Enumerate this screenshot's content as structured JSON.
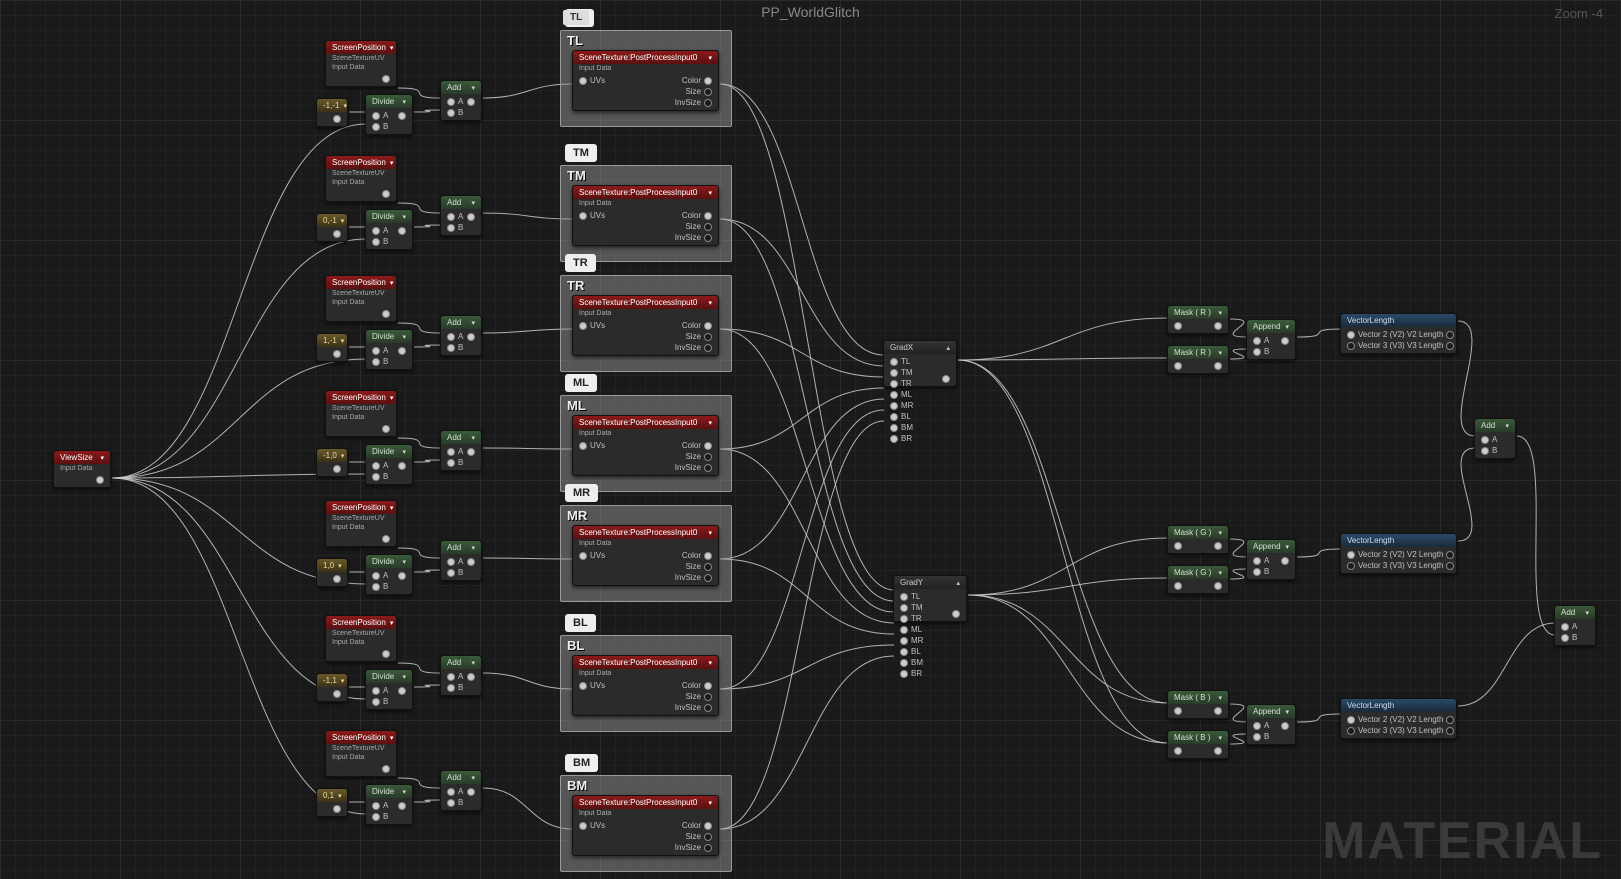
{
  "title": "PP_WorldGlitch",
  "zoom": "Zoom -4",
  "watermark": "MATERIAL",
  "labels": {
    "screenPosition": "ScreenPosition",
    "sceneTextureUV": "SceneTextureUV",
    "inputData": "Input Data",
    "viewSize": "ViewSize",
    "divide": "Divide",
    "add": "Add",
    "sceneTexture": "SceneTexture:PostProcessInput0",
    "uvs": "UVs",
    "color": "Color",
    "size": "Size",
    "invSize": "InvSize",
    "gradX": "GradX",
    "gradY": "GradY",
    "a": "A",
    "b": "B",
    "maskR": "Mask ( R )",
    "maskG": "Mask ( G )",
    "maskB": "Mask ( B )",
    "append": "Append",
    "vectorLength": "VectorLength",
    "v2": "Vector 2 (V2)  V2 Length",
    "v3": "Vector 3 (V3)  V3 Length",
    "tl": "TL",
    "tm": "TM",
    "tr": "TR",
    "ml": "ML",
    "mr": "MR",
    "bl": "BL",
    "bm": "BM",
    "br": "BR"
  },
  "offsets": [
    "-1,-1",
    "0,-1",
    "1,-1",
    "-1,0",
    "1,0",
    "-1,1",
    "0,1"
  ],
  "rows": [
    "TL",
    "TM",
    "TR",
    "ML",
    "MR",
    "BL",
    "BM"
  ],
  "gradPins": [
    "TL",
    "TM",
    "TR",
    "ML",
    "MR",
    "BL",
    "BM",
    "BR"
  ]
}
